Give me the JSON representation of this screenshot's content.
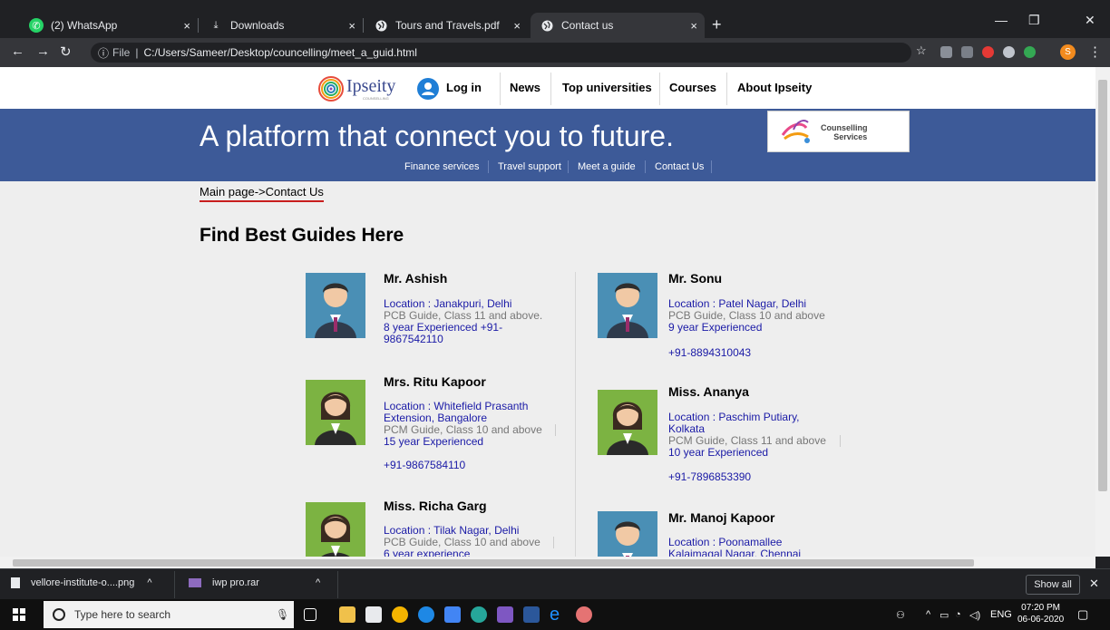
{
  "browser": {
    "tabs": [
      {
        "title": "(2) WhatsApp",
        "icon": "whatsapp-icon",
        "active": false
      },
      {
        "title": "Downloads",
        "icon": "download-icon",
        "active": false
      },
      {
        "title": "Tours and Travels.pdf",
        "icon": "globe-icon",
        "active": false
      },
      {
        "title": "Contact us",
        "icon": "globe-icon",
        "active": true
      }
    ],
    "new_tab": "+",
    "close_glyph": "×",
    "address": {
      "scheme_label": "File",
      "url": "C:/Users/Sameer/Desktop/councelling/meet_a_guid.html"
    },
    "profile_initial": "S"
  },
  "site": {
    "brand": "Ipseity",
    "brand_sub": "COUNSELLING",
    "nav": {
      "login": "Log in",
      "news": "News",
      "top_universities": "Top universities",
      "courses": "Courses",
      "about": "About Ipseity"
    },
    "banner": {
      "title": "A platform that connect you to future.",
      "badge_line1": "Counselling",
      "badge_line2": "Services",
      "links": [
        "Finance services",
        "Travel support",
        "Meet a guide",
        "Contact Us"
      ]
    },
    "breadcrumb": "Main page->Contact Us",
    "section_title": "Find Best Guides Here",
    "guides_left": [
      {
        "name": "Mr. Ashish",
        "location": "Location : Janakpuri, Delhi",
        "spec": "PCB Guide, Class 11 and above.",
        "exp": "8 year Experienced +91-",
        "phone": "9867542110",
        "gender": "male"
      },
      {
        "name": "Mrs. Ritu Kapoor",
        "location": "Location : Whitefield Prasanth",
        "location2": "Extension, Bangalore",
        "spec": "PCM Guide, Class 10 and above",
        "exp": "15 year Experienced",
        "phone": "+91-9867584110",
        "gender": "female"
      },
      {
        "name": "Miss. Richa Garg",
        "location": "Location : Tilak Nagar, Delhi",
        "spec": "PCB Guide, Class 10 and above",
        "exp": "6 year experience",
        "gender": "female"
      }
    ],
    "guides_right": [
      {
        "name": "Mr. Sonu",
        "location": "Location : Patel Nagar, Delhi",
        "spec": "PCB Guide, Class 10 and above",
        "exp": "9 year Experienced",
        "phone": "+91-8894310043",
        "gender": "male"
      },
      {
        "name": "Miss. Ananya",
        "location": "Location : Paschim Putiary,",
        "location2": "Kolkata",
        "spec": "PCM Guide, Class 11 and above",
        "exp": "10 year Experienced",
        "phone": "+91-7896853390",
        "gender": "female"
      },
      {
        "name": "Mr. Manoj Kapoor",
        "location": "Location : Poonamallee",
        "location2": "Kalaimagal Nagar, Chennai",
        "gender": "male"
      }
    ]
  },
  "downloads": {
    "items": [
      "vellore-institute-o....png",
      "iwp pro.rar"
    ],
    "show_all": "Show all"
  },
  "taskbar": {
    "search_placeholder": "Type here to search",
    "lang": "ENG",
    "time": "07:20 PM",
    "date": "06-06-2020"
  },
  "colors": {
    "banner": "#3d5a98",
    "breadcrumb_underline": "#c81e1e",
    "guide_text": "#1a1aa6"
  }
}
